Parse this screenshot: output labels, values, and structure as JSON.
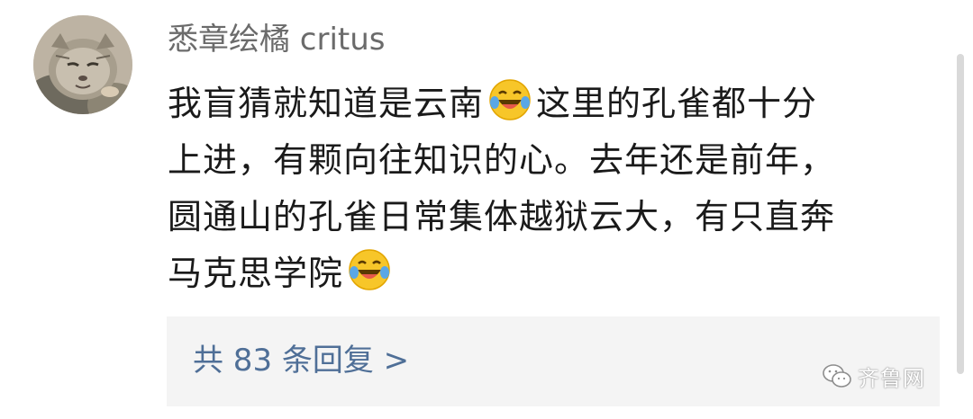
{
  "comment": {
    "username": "悉章绘橘 critus",
    "lines": [
      {
        "before": "我盲猜就知道是云南",
        "emoji": "laughing-crying-emoji",
        "after": "这里的孔雀都十分"
      },
      {
        "before": "上进，有颗向往知识的心。去年还是前年，"
      },
      {
        "before": "圆通山的孔雀日常集体越狱云大，有只直奔"
      },
      {
        "before": "马克思学院",
        "emoji": "laughing-crying-emoji",
        "after": ""
      }
    ]
  },
  "replies": {
    "label": "共 83 条回复 >"
  },
  "watermark": {
    "text": "齐鲁网"
  },
  "colors": {
    "username": "#6b6b6b",
    "body_text": "#1a1a1a",
    "reply_link": "#4f6f97",
    "reply_bg": "#f4f4f4"
  }
}
